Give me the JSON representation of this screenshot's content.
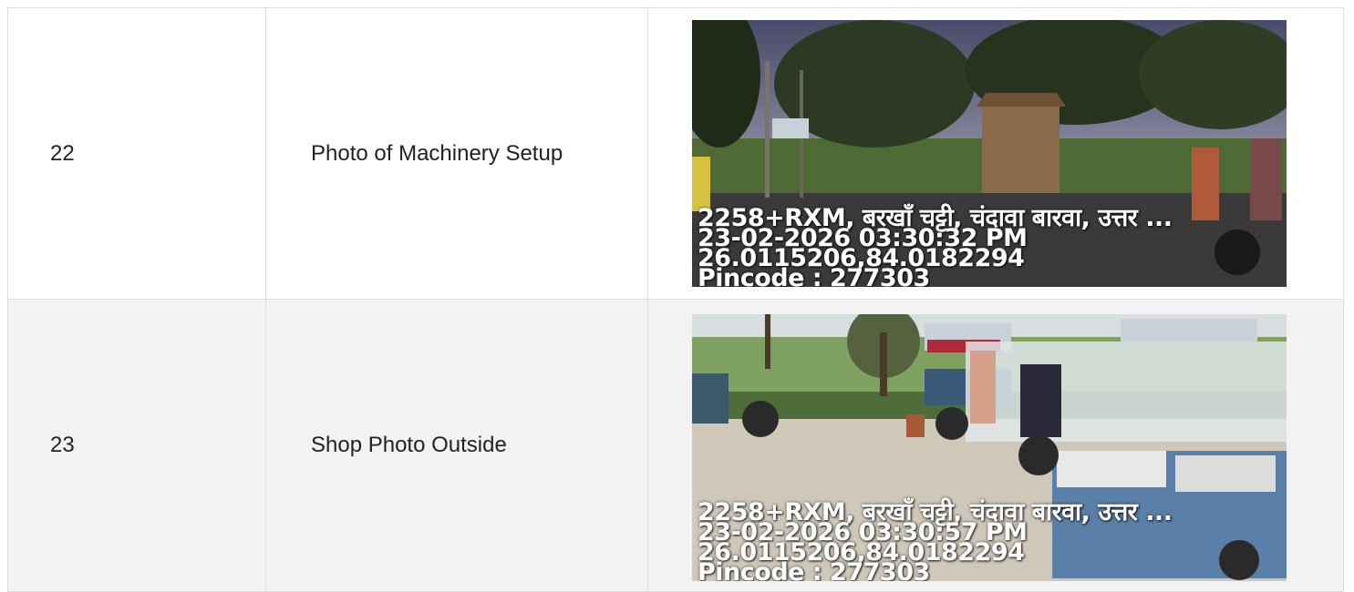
{
  "rows": [
    {
      "number": "22",
      "label": "Photo of Machinery Setup",
      "photo": {
        "address": "2258+RXM, बरखाँ चट्टी, चंदावा बारवा, उत्तर ...",
        "datetime": "23-02-2026 03:30:32 PM",
        "coords": "26.0115206,84.0182294",
        "pincode": "Pincode : 277303"
      }
    },
    {
      "number": "23",
      "label": "Shop Photo Outside",
      "photo": {
        "address": "2258+RXM, बरखाँ चट्टी, चंदावा बारवा, उत्तर ...",
        "datetime": "23-02-2026 03:30:57 PM",
        "coords": "26.0115206,84.0182294",
        "pincode": "Pincode : 277303"
      }
    }
  ]
}
